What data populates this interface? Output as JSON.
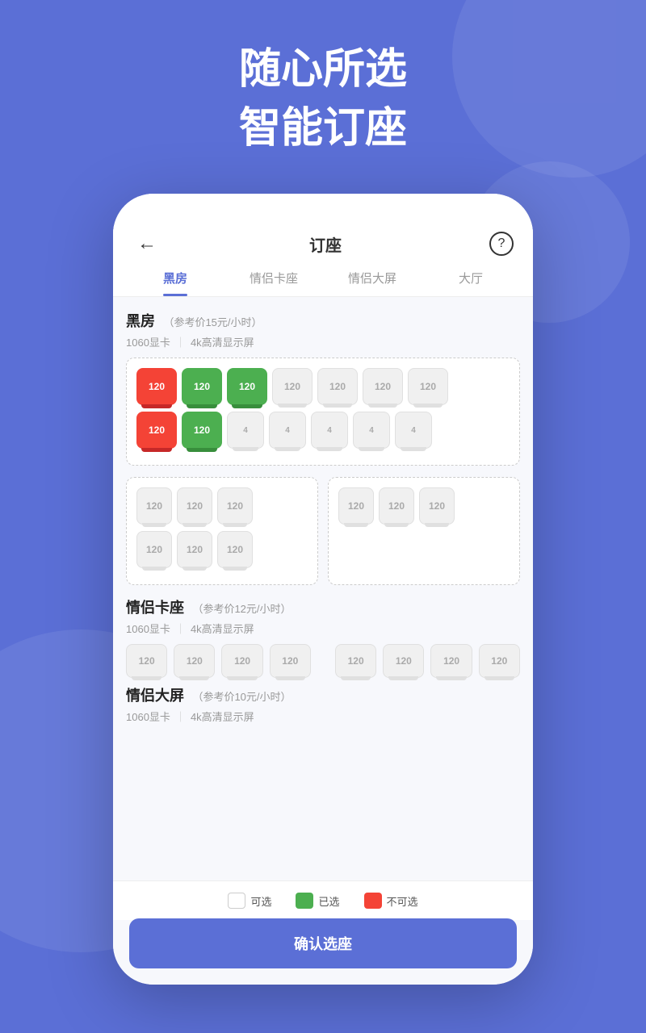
{
  "hero": {
    "line1": "随心所选",
    "line2": "智能订座"
  },
  "header": {
    "back_icon": "←",
    "title": "订座",
    "help_icon": "?"
  },
  "tabs": [
    {
      "label": "黑房",
      "active": true
    },
    {
      "label": "情侣卡座",
      "active": false
    },
    {
      "label": "情侣大屏",
      "active": false
    },
    {
      "label": "大厅",
      "active": false
    }
  ],
  "sections": [
    {
      "title": "黑房",
      "price": "（参考价15元/小时）",
      "specs": "1060显卡",
      "specs2": "4k高清显示屏",
      "seats_row1": [
        {
          "num": "120",
          "status": "occupied"
        },
        {
          "num": "120",
          "status": "selected"
        },
        {
          "num": "120",
          "status": "selected"
        },
        {
          "num": "120",
          "status": "available"
        },
        {
          "num": "120",
          "status": "available"
        },
        {
          "num": "120",
          "status": "available"
        },
        {
          "num": "120",
          "status": "available"
        }
      ],
      "seats_row2": [
        {
          "num": "120",
          "status": "occupied"
        },
        {
          "num": "120",
          "status": "selected"
        },
        {
          "num": "4",
          "status": "available"
        },
        {
          "num": "4",
          "status": "available"
        },
        {
          "num": "4",
          "status": "available"
        },
        {
          "num": "4",
          "status": "available"
        },
        {
          "num": "4",
          "status": "available"
        }
      ]
    },
    {
      "title": "情侣卡座",
      "price": "（参考价12元/小时）",
      "specs": "1060显卡",
      "specs2": "4k高清显示屏"
    },
    {
      "title": "情侣大屏",
      "price": "（参考价10元/小时）",
      "specs": "1060显卡",
      "specs2": "4k高清显示屏"
    }
  ],
  "legend": {
    "available": "可选",
    "selected": "已选",
    "occupied": "不可选"
  },
  "confirm_button": "确认选座"
}
